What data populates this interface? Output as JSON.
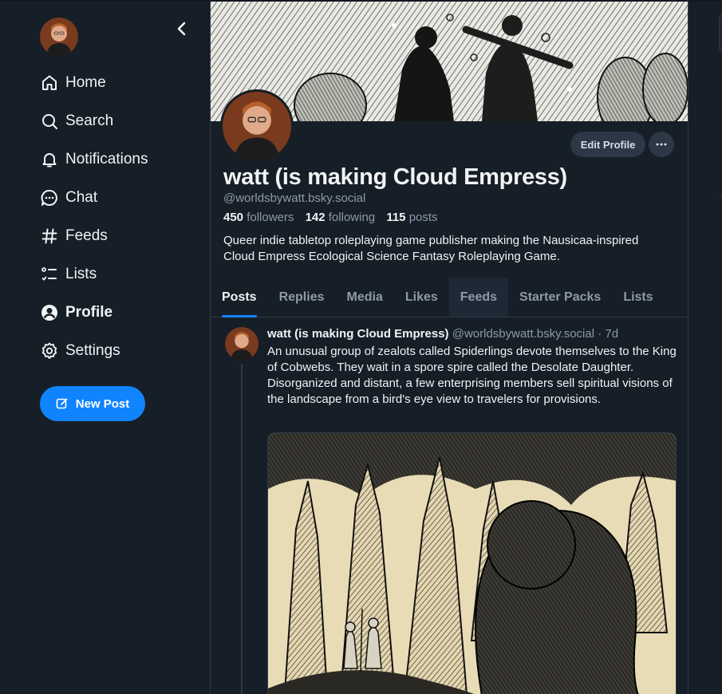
{
  "colors": {
    "background": "#161e27",
    "accent": "#1083fe",
    "text_primary": "#f1f3f5",
    "text_secondary": "#8e9aa8",
    "border": "#2e3a48"
  },
  "sidebar": {
    "items": [
      {
        "label": "Home",
        "icon": "home-icon",
        "active": false
      },
      {
        "label": "Search",
        "icon": "search-icon",
        "active": false
      },
      {
        "label": "Notifications",
        "icon": "bell-icon",
        "active": false
      },
      {
        "label": "Chat",
        "icon": "chat-bubble-icon",
        "active": false
      },
      {
        "label": "Feeds",
        "icon": "hash-icon",
        "active": false
      },
      {
        "label": "Lists",
        "icon": "list-icon",
        "active": false
      },
      {
        "label": "Profile",
        "icon": "user-circle-icon",
        "active": true
      },
      {
        "label": "Settings",
        "icon": "gear-icon",
        "active": false
      }
    ],
    "new_post_label": "New Post"
  },
  "profile": {
    "display_name": "watt (is making Cloud Empress)",
    "handle": "@worldsbywatt.bsky.social",
    "followers_count": "450",
    "followers_label": "followers",
    "following_count": "142",
    "following_label": "following",
    "posts_count": "115",
    "posts_label": "posts",
    "bio_line1": "Queer indie tabletop roleplaying game publisher making the Nausicaa-inspired",
    "bio_line2": "Cloud Empress Ecological Science Fantasy Roleplaying Game.",
    "edit_profile_label": "Edit Profile"
  },
  "tabs": [
    {
      "label": "Posts",
      "active": true
    },
    {
      "label": "Replies",
      "active": false
    },
    {
      "label": "Media",
      "active": false
    },
    {
      "label": "Likes",
      "active": false
    },
    {
      "label": "Feeds",
      "active": false,
      "hover": true
    },
    {
      "label": "Starter Packs",
      "active": false
    },
    {
      "label": "Lists",
      "active": false
    }
  ],
  "post": {
    "author": "watt (is making Cloud Empress)",
    "handle": "@worldsbywatt.bsky.social",
    "separator": "·",
    "time": "7d",
    "text": "An unusual group of zealots called Spiderlings devote themselves to the King of Cobwebs. They wait in a spore spire called the Desolate Daughter. Disorganized and distant, a few enterprising members sell spiritual visions of the landscape from a bird's eye view to travelers for provisions."
  }
}
